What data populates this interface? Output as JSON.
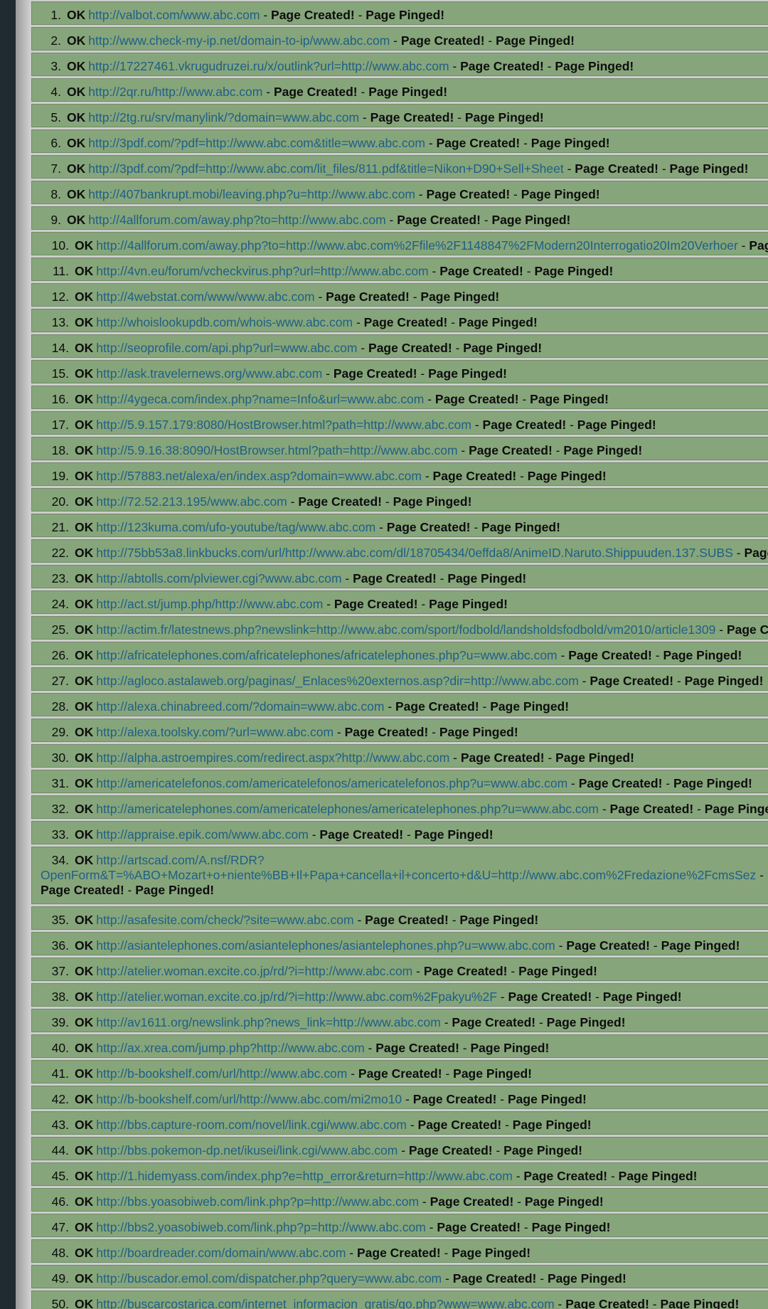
{
  "labels": {
    "ok": "OK",
    "dash": " - ",
    "created": "Page Created!",
    "pinged": "Page Pinged!"
  },
  "results": [
    {
      "n": "1.",
      "url": "http://valbot.com/www.abc.com"
    },
    {
      "n": "2.",
      "url": "http://www.check-my-ip.net/domain-to-ip/www.abc.com"
    },
    {
      "n": "3.",
      "url": "http://17227461.vkrugudruzei.ru/x/outlink?url=http://www.abc.com"
    },
    {
      "n": "4.",
      "url": "http://2qr.ru/http://www.abc.com"
    },
    {
      "n": "5.",
      "url": "http://2tg.ru/srv/manylink/?domain=www.abc.com"
    },
    {
      "n": "6.",
      "url": "http://3pdf.com/?pdf=http://www.abc.com&title=www.abc.com"
    },
    {
      "n": "7.",
      "url": "http://3pdf.com/?pdf=http://www.abc.com/lit_files/811.pdf&title=Nikon+D90+Sell+Sheet"
    },
    {
      "n": "8.",
      "url": "http://407bankrupt.mobi/leaving.php?u=http://www.abc.com"
    },
    {
      "n": "9.",
      "url": "http://4allforum.com/away.php?to=http://www.abc.com"
    },
    {
      "n": "10.",
      "url": "http://4allforum.com/away.php?to=http://www.abc.com%2Ffile%2F1148847%2FModern20Interrogatio20Im20Verhoer"
    },
    {
      "n": "11.",
      "url": "http://4vn.eu/forum/vcheckvirus.php?url=http://www.abc.com"
    },
    {
      "n": "12.",
      "url": "http://4webstat.com/www/www.abc.com"
    },
    {
      "n": "13.",
      "url": "http://whoislookupdb.com/whois-www.abc.com"
    },
    {
      "n": "14.",
      "url": "http://seoprofile.com/api.php?url=www.abc.com"
    },
    {
      "n": "15.",
      "url": "http://ask.travelernews.org/www.abc.com"
    },
    {
      "n": "16.",
      "url": "http://4ygeca.com/index.php?name=Info&url=www.abc.com"
    },
    {
      "n": "17.",
      "url": "http://5.9.157.179:8080/HostBrowser.html?path=http://www.abc.com"
    },
    {
      "n": "18.",
      "url": "http://5.9.16.38:8090/HostBrowser.html?path=http://www.abc.com"
    },
    {
      "n": "19.",
      "url": "http://57883.net/alexa/en/index.asp?domain=www.abc.com"
    },
    {
      "n": "20.",
      "url": "http://72.52.213.195/www.abc.com"
    },
    {
      "n": "21.",
      "url": "http://123kuma.com/ufo-youtube/tag/www.abc.com"
    },
    {
      "n": "22.",
      "url": "http://75bb53a8.linkbucks.com/url/http://www.abc.com/dl/18705434/0effda8/AnimeID.Naruto.Shippuuden.137.SUBS"
    },
    {
      "n": "23.",
      "url": "http://abtolls.com/plviewer.cgi?www.abc.com"
    },
    {
      "n": "24.",
      "url": "http://act.st/jump.php/http://www.abc.com"
    },
    {
      "n": "25.",
      "url": "http://actim.fr/latestnews.php?newslink=http://www.abc.com/sport/fodbold/landsholdsfodbold/vm2010/article1309"
    },
    {
      "n": "26.",
      "url": "http://africatelephones.com/africatelephones/africatelephones.php?u=www.abc.com"
    },
    {
      "n": "27.",
      "url": "http://agloco.astalaweb.org/paginas/_Enlaces%20externos.asp?dir=http://www.abc.com"
    },
    {
      "n": "28.",
      "url": "http://alexa.chinabreed.com/?domain=www.abc.com"
    },
    {
      "n": "29.",
      "url": "http://alexa.toolsky.com/?url=www.abc.com"
    },
    {
      "n": "30.",
      "url": "http://alpha.astroempires.com/redirect.aspx?http://www.abc.com"
    },
    {
      "n": "31.",
      "url": "http://americatelefonos.com/americatelefonos/americatelefonos.php?u=www.abc.com"
    },
    {
      "n": "32.",
      "url": "http://americatelephones.com/americatelephones/americatelephones.php?u=www.abc.com"
    },
    {
      "n": "33.",
      "url": "http://appraise.epik.com/www.abc.com"
    },
    {
      "n": "34.",
      "url": "http://artscad.com/A.nsf/RDR?OpenForm&T=%ABO+Mozart+o+niente%BB+Il+Papa+cancella+il+concerto+d&U=http://www.abc.com%2Fredazione%2FcmsSez",
      "wrap": true
    },
    {
      "n": "35.",
      "url": "http://asafesite.com/check/?site=www.abc.com"
    },
    {
      "n": "36.",
      "url": "http://asiantelephones.com/asiantelephones/asiantelephones.php?u=www.abc.com"
    },
    {
      "n": "37.",
      "url": "http://atelier.woman.excite.co.jp/rd/?i=http://www.abc.com"
    },
    {
      "n": "38.",
      "url": "http://atelier.woman.excite.co.jp/rd/?i=http://www.abc.com%2Fpakyu%2F"
    },
    {
      "n": "39.",
      "url": "http://av1611.org/newslink.php?news_link=http://www.abc.com"
    },
    {
      "n": "40.",
      "url": "http://ax.xrea.com/jump.php?http://www.abc.com"
    },
    {
      "n": "41.",
      "url": "http://b-bookshelf.com/url/http://www.abc.com"
    },
    {
      "n": "42.",
      "url": "http://b-bookshelf.com/url/http://www.abc.com/mi2mo10"
    },
    {
      "n": "43.",
      "url": "http://bbs.capture-room.com/novel/link.cgi/www.abc.com"
    },
    {
      "n": "44.",
      "url": "http://bbs.pokemon-dp.net/ikusei/link.cgi/www.abc.com"
    },
    {
      "n": "45.",
      "url": "http://1.hidemyass.com/index.php?e=http_error&return=http://www.abc.com"
    },
    {
      "n": "46.",
      "url": "http://bbs.yoasobiweb.com/link.php?p=http://www.abc.com"
    },
    {
      "n": "47.",
      "url": "http://bbs2.yoasobiweb.com/link.php?p=http://www.abc.com"
    },
    {
      "n": "48.",
      "url": "http://boardreader.com/domain/www.abc.com"
    },
    {
      "n": "49.",
      "url": "http://buscador.emol.com/dispatcher.php?query=www.abc.com"
    },
    {
      "n": "50.",
      "url": "http://buscarcostarica.com/internet_informacion_gratis/go.php?www=www.abc.com"
    }
  ]
}
